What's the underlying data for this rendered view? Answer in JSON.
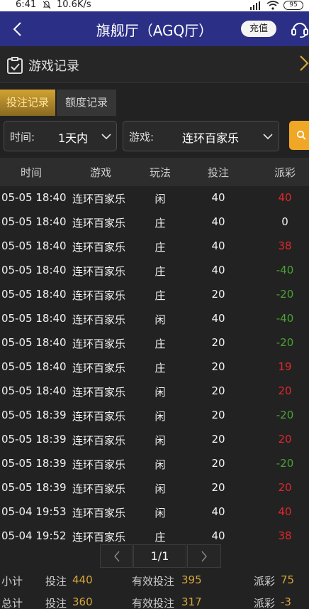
{
  "status_bar": {
    "time": "6:41",
    "speed": "10.6K/s",
    "battery": "95"
  },
  "header": {
    "title": "旗舰厅（AGQ厅）",
    "recharge_label": "充值"
  },
  "page": {
    "title": "游戏记录"
  },
  "tabs": [
    {
      "label": "投注记录",
      "active": true
    },
    {
      "label": "额度记录",
      "active": false
    }
  ],
  "filters": {
    "time_label": "时间:",
    "time_value": "1天内",
    "game_label": "游戏:",
    "game_value": "连环百家乐"
  },
  "table": {
    "headers": [
      "时间",
      "游戏",
      "玩法",
      "投注",
      "派彩"
    ],
    "rows": [
      {
        "time": "05-05 18:40",
        "game": "连环百家乐",
        "play": "闲",
        "bet": "40",
        "payout": "40"
      },
      {
        "time": "05-05 18:40",
        "game": "连环百家乐",
        "play": "庄",
        "bet": "40",
        "payout": "0"
      },
      {
        "time": "05-05 18:40",
        "game": "连环百家乐",
        "play": "庄",
        "bet": "40",
        "payout": "38"
      },
      {
        "time": "05-05 18:40",
        "game": "连环百家乐",
        "play": "庄",
        "bet": "40",
        "payout": "-40"
      },
      {
        "time": "05-05 18:40",
        "game": "连环百家乐",
        "play": "庄",
        "bet": "20",
        "payout": "-20"
      },
      {
        "time": "05-05 18:40",
        "game": "连环百家乐",
        "play": "闲",
        "bet": "40",
        "payout": "-40"
      },
      {
        "time": "05-05 18:40",
        "game": "连环百家乐",
        "play": "庄",
        "bet": "20",
        "payout": "-20"
      },
      {
        "time": "05-05 18:40",
        "game": "连环百家乐",
        "play": "庄",
        "bet": "20",
        "payout": "19"
      },
      {
        "time": "05-05 18:40",
        "game": "连环百家乐",
        "play": "闲",
        "bet": "20",
        "payout": "20"
      },
      {
        "time": "05-05 18:39",
        "game": "连环百家乐",
        "play": "闲",
        "bet": "20",
        "payout": "-20"
      },
      {
        "time": "05-05 18:39",
        "game": "连环百家乐",
        "play": "闲",
        "bet": "20",
        "payout": "20"
      },
      {
        "time": "05-05 18:39",
        "game": "连环百家乐",
        "play": "闲",
        "bet": "20",
        "payout": "-20"
      },
      {
        "time": "05-05 18:39",
        "game": "连环百家乐",
        "play": "闲",
        "bet": "20",
        "payout": "20"
      },
      {
        "time": "05-04 19:53",
        "game": "连环百家乐",
        "play": "闲",
        "bet": "40",
        "payout": "40"
      },
      {
        "time": "05-04 19:52",
        "game": "连环百家乐",
        "play": "庄",
        "bet": "40",
        "payout": "38"
      }
    ]
  },
  "pager": {
    "label": "1/1"
  },
  "subtotal": {
    "label": "小计",
    "bet_label": "投注",
    "bet": "440",
    "valid_label": "有效投注",
    "valid": "395",
    "payout_label": "派彩",
    "payout": "75"
  },
  "total": {
    "label": "总计",
    "bet_label": "投注",
    "bet": "360",
    "valid_label": "有效投注",
    "valid": "317",
    "payout_label": "派彩",
    "payout": "-3"
  },
  "colors": {
    "header_bg": "#2b2f86",
    "accent_gold": "#d6a63a",
    "search_orange": "#f0a725",
    "win_red": "#e0282b",
    "loss_green": "#4aa233"
  }
}
